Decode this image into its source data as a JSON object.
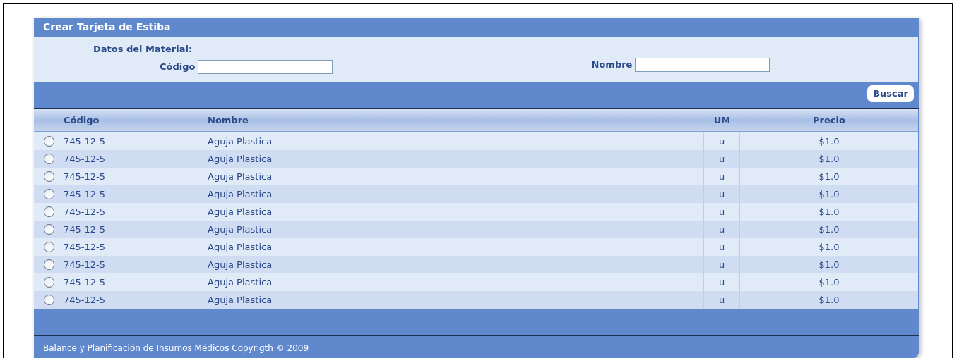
{
  "window": {
    "title": "Crear Tarjeta de Estiba"
  },
  "form": {
    "section_label": "Datos del Material:",
    "fields": [
      {
        "label": "Código"
      },
      {
        "label": "Nombre"
      }
    ],
    "search_button": "Buscar"
  },
  "table": {
    "columns": [
      "Código",
      "Nombre",
      "UM",
      "Precio"
    ],
    "rows": [
      {
        "selected": false,
        "code": "745-12-5",
        "name": "Aguja Plastica",
        "um": "u",
        "price": "$1.0"
      },
      {
        "selected": false,
        "code": "745-12-5",
        "name": "Aguja Plastica",
        "um": "u",
        "price": "$1.0"
      },
      {
        "selected": false,
        "code": "745-12-5",
        "name": "Aguja Plastica",
        "um": "u",
        "price": "$1.0"
      },
      {
        "selected": false,
        "code": "745-12-5",
        "name": "Aguja Plastica",
        "um": "u",
        "price": "$1.0"
      },
      {
        "selected": false,
        "code": "745-12-5",
        "name": "Aguja Plastica",
        "um": "u",
        "price": "$1.0"
      },
      {
        "selected": false,
        "code": "745-12-5",
        "name": "Aguja Plastica",
        "um": "u",
        "price": "$1.0"
      },
      {
        "selected": false,
        "code": "745-12-5",
        "name": "Aguja Plastica",
        "um": "u",
        "price": "$1.0"
      },
      {
        "selected": false,
        "code": "745-12-5",
        "name": "Aguja Plastica",
        "um": "u",
        "price": "$1.0"
      },
      {
        "selected": false,
        "code": "745-12-5",
        "name": "Aguja Plastica",
        "um": "u",
        "price": "$1.0"
      },
      {
        "selected": false,
        "code": "745-12-5",
        "name": "Aguja Plastica",
        "um": "u",
        "price": "$1.0"
      }
    ]
  },
  "footer": "Balance y Planificación de Insumos Médicos Copyrigth © 2009"
}
